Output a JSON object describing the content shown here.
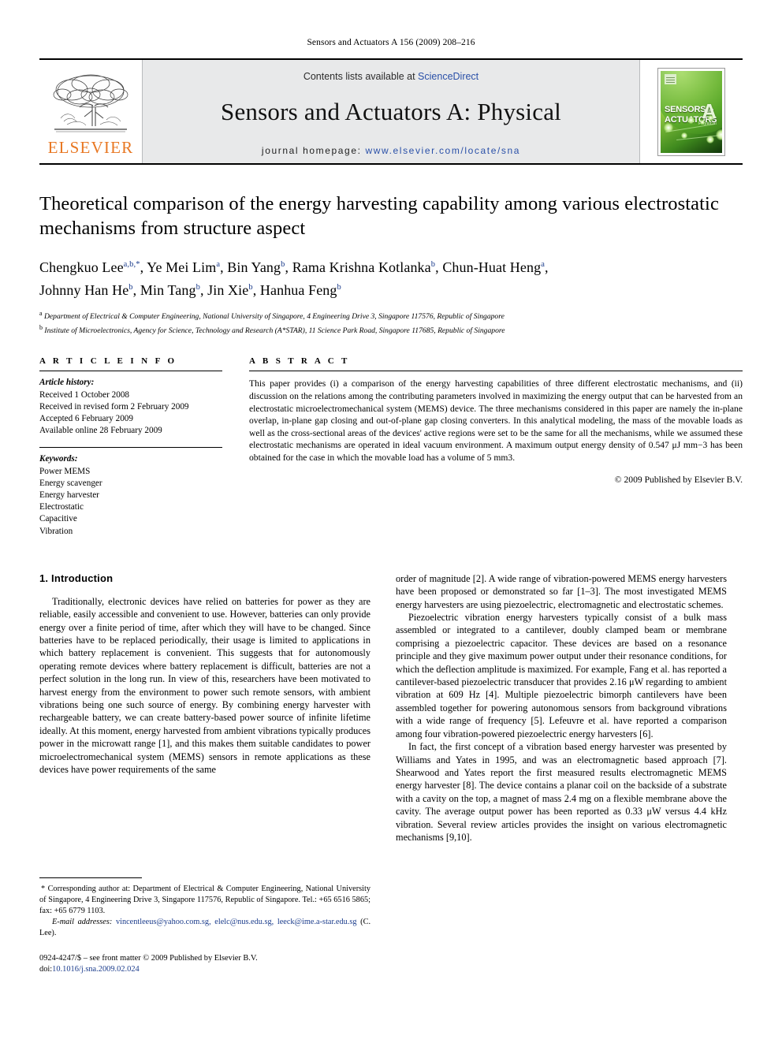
{
  "running_head": "Sensors and Actuators A 156 (2009) 208–216",
  "masthead": {
    "contents_prefix": "Contents lists available at ",
    "sciencedirect": "ScienceDirect",
    "journal_title": "Sensors and Actuators A: Physical",
    "homepage_label": "journal homepage:",
    "homepage_url": "www.elsevier.com/locate/sna",
    "publisher_logo_text": "ELSEVIER",
    "cover": {
      "line1": "SENSORS",
      "line1_small": "and",
      "line2": "ACTUATORS",
      "letter": "A",
      "sub": "Physical"
    }
  },
  "article": {
    "title": "Theoretical comparison of the energy harvesting capability among various electrostatic mechanisms from structure aspect",
    "authors_line1": "Chengkuo Lee",
    "authors": [
      {
        "name": "Chengkuo Lee",
        "sup": "a,b,",
        "star": true
      },
      {
        "name": "Ye Mei Lim",
        "sup": "a"
      },
      {
        "name": "Bin Yang",
        "sup": "b"
      },
      {
        "name": "Rama Krishna Kotlanka",
        "sup": "b"
      },
      {
        "name": "Chun-Huat Heng",
        "sup": "a"
      },
      {
        "name": "Johnny Han He",
        "sup": "b"
      },
      {
        "name": "Min Tang",
        "sup": "b"
      },
      {
        "name": "Jin Xie",
        "sup": "b"
      },
      {
        "name": "Hanhua Feng",
        "sup": "b"
      }
    ],
    "affiliations": [
      {
        "mark": "a",
        "text": "Department of Electrical & Computer Engineering, National University of Singapore, 4 Engineering Drive 3, Singapore 117576, Republic of Singapore"
      },
      {
        "mark": "b",
        "text": "Institute of Microelectronics, Agency for Science, Technology and Research (A*STAR), 11 Science Park Road, Singapore 117685, Republic of Singapore"
      }
    ]
  },
  "info": {
    "heading": "A R T I C L E   I N F O",
    "history_label": "Article history:",
    "history": [
      "Received 1 October 2008",
      "Received in revised form 2 February 2009",
      "Accepted 6 February 2009",
      "Available online 28 February 2009"
    ],
    "keywords_label": "Keywords:",
    "keywords": [
      "Power MEMS",
      "Energy scavenger",
      "Energy harvester",
      "Electrostatic",
      "Capacitive",
      "Vibration"
    ]
  },
  "abstract": {
    "heading": "A B S T R A C T",
    "text": "This paper provides (i) a comparison of the energy harvesting capabilities of three different electrostatic mechanisms, and (ii) discussion on the relations among the contributing parameters involved in maximizing the energy output that can be harvested from an electrostatic microelectromechanical system (MEMS) device. The three mechanisms considered in this paper are namely the in-plane overlap, in-plane gap closing and out-of-plane gap closing converters. In this analytical modeling, the mass of the movable loads as well as the cross-sectional areas of the devices' active regions were set to be the same for all the mechanisms, while we assumed these electrostatic mechanisms are operated in ideal vacuum environment. A maximum output energy density of 0.547 μJ mm−3 has been obtained for the case in which the movable load has a volume of 5 mm3.",
    "copyright": "© 2009 Published by Elsevier B.V."
  },
  "body": {
    "section_number_title": "1.  Introduction",
    "left_paragraphs": [
      "Traditionally, electronic devices have relied on batteries for power as they are reliable, easily accessible and convenient to use. However, batteries can only provide energy over a finite period of time, after which they will have to be changed. Since batteries have to be replaced periodically, their usage is limited to applications in which battery replacement is convenient. This suggests that for autonomously operating remote devices where battery replacement is difficult, batteries are not a perfect solution in the long run. In view of this, researchers have been motivated to harvest energy from the environment to power such remote sensors, with ambient vibrations being one such source of energy. By combining energy harvester with rechargeable battery, we can create battery-based power source of infinite lifetime ideally. At this moment, energy harvested from ambient vibrations typically produces power in the microwatt range [1], and this makes them suitable candidates to power microelectromechanical system (MEMS) sensors in remote applications as these devices have power requirements of the same"
    ],
    "right_paragraphs": [
      "order of magnitude [2]. A wide range of vibration-powered MEMS energy harvesters have been proposed or demonstrated so far [1–3]. The most investigated MEMS energy harvesters are using piezoelectric, electromagnetic and electrostatic schemes.",
      "Piezoelectric vibration energy harvesters typically consist of a bulk mass assembled or integrated to a cantilever, doubly clamped beam or membrane comprising a piezoelectric capacitor. These devices are based on a resonance principle and they give maximum power output under their resonance conditions, for which the deflection amplitude is maximized. For example, Fang et al. has reported a cantilever-based piezoelectric transducer that provides 2.16 μW regarding to ambient vibration at 609 Hz [4]. Multiple piezoelectric bimorph cantilevers have been assembled together for powering autonomous sensors from background vibrations with a wide range of frequency [5]. Lefeuvre et al. have reported a comparison among four vibration-powered piezoelectric energy harvesters [6].",
      "In fact, the first concept of a vibration based energy harvester was presented by Williams and Yates in 1995, and was an electromagnetic based approach [7]. Shearwood and Yates report the first measured results electromagnetic MEMS energy harvester [8]. The device contains a planar coil on the backside of a substrate with a cavity on the top, a magnet of mass 2.4 mg on a flexible membrane above the cavity. The average output power has been reported as 0.33 μW versus 4.4 kHz vibration. Several review articles provides the insight on various electromagnetic mechanisms [9,10]."
    ]
  },
  "footnote": {
    "star": "*",
    "corresponding": "Corresponding author at: Department of Electrical & Computer Engineering, National University of Singapore, 4 Engineering Drive 3, Singapore 117576, Republic of Singapore. Tel.: +65 6516 5865; fax: +65 6779 1103.",
    "email_label": "E-mail addresses:",
    "emails": "vincentleeus@yahoo.com.sg, elelc@nus.edu.sg, leeck@ime.a-star.edu.sg",
    "email_owner": "(C. Lee)."
  },
  "footer": {
    "issn_line": "0924-4247/$ – see front matter © 2009 Published by Elsevier B.V.",
    "doi_label": "doi:",
    "doi": "10.1016/j.sna.2009.02.024"
  },
  "colors": {
    "link": "#1b3c8c",
    "elsevier_orange": "#E87722",
    "masthead_bg": "#e8e9ea"
  }
}
